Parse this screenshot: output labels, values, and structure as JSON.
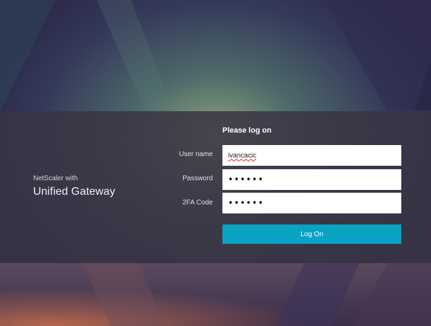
{
  "brand": {
    "line1": "NetScaler with",
    "line2": "Unified Gateway"
  },
  "form": {
    "title": "Please log on",
    "username_label": "User name",
    "username_value": "ivancacic",
    "password_label": "Password",
    "password_value": "••••••",
    "twofa_label": "2FA Code",
    "twofa_value": "••••••",
    "submit_label": "Log On"
  },
  "colors": {
    "button": "#0aa3c4",
    "band": "#3a3444"
  }
}
